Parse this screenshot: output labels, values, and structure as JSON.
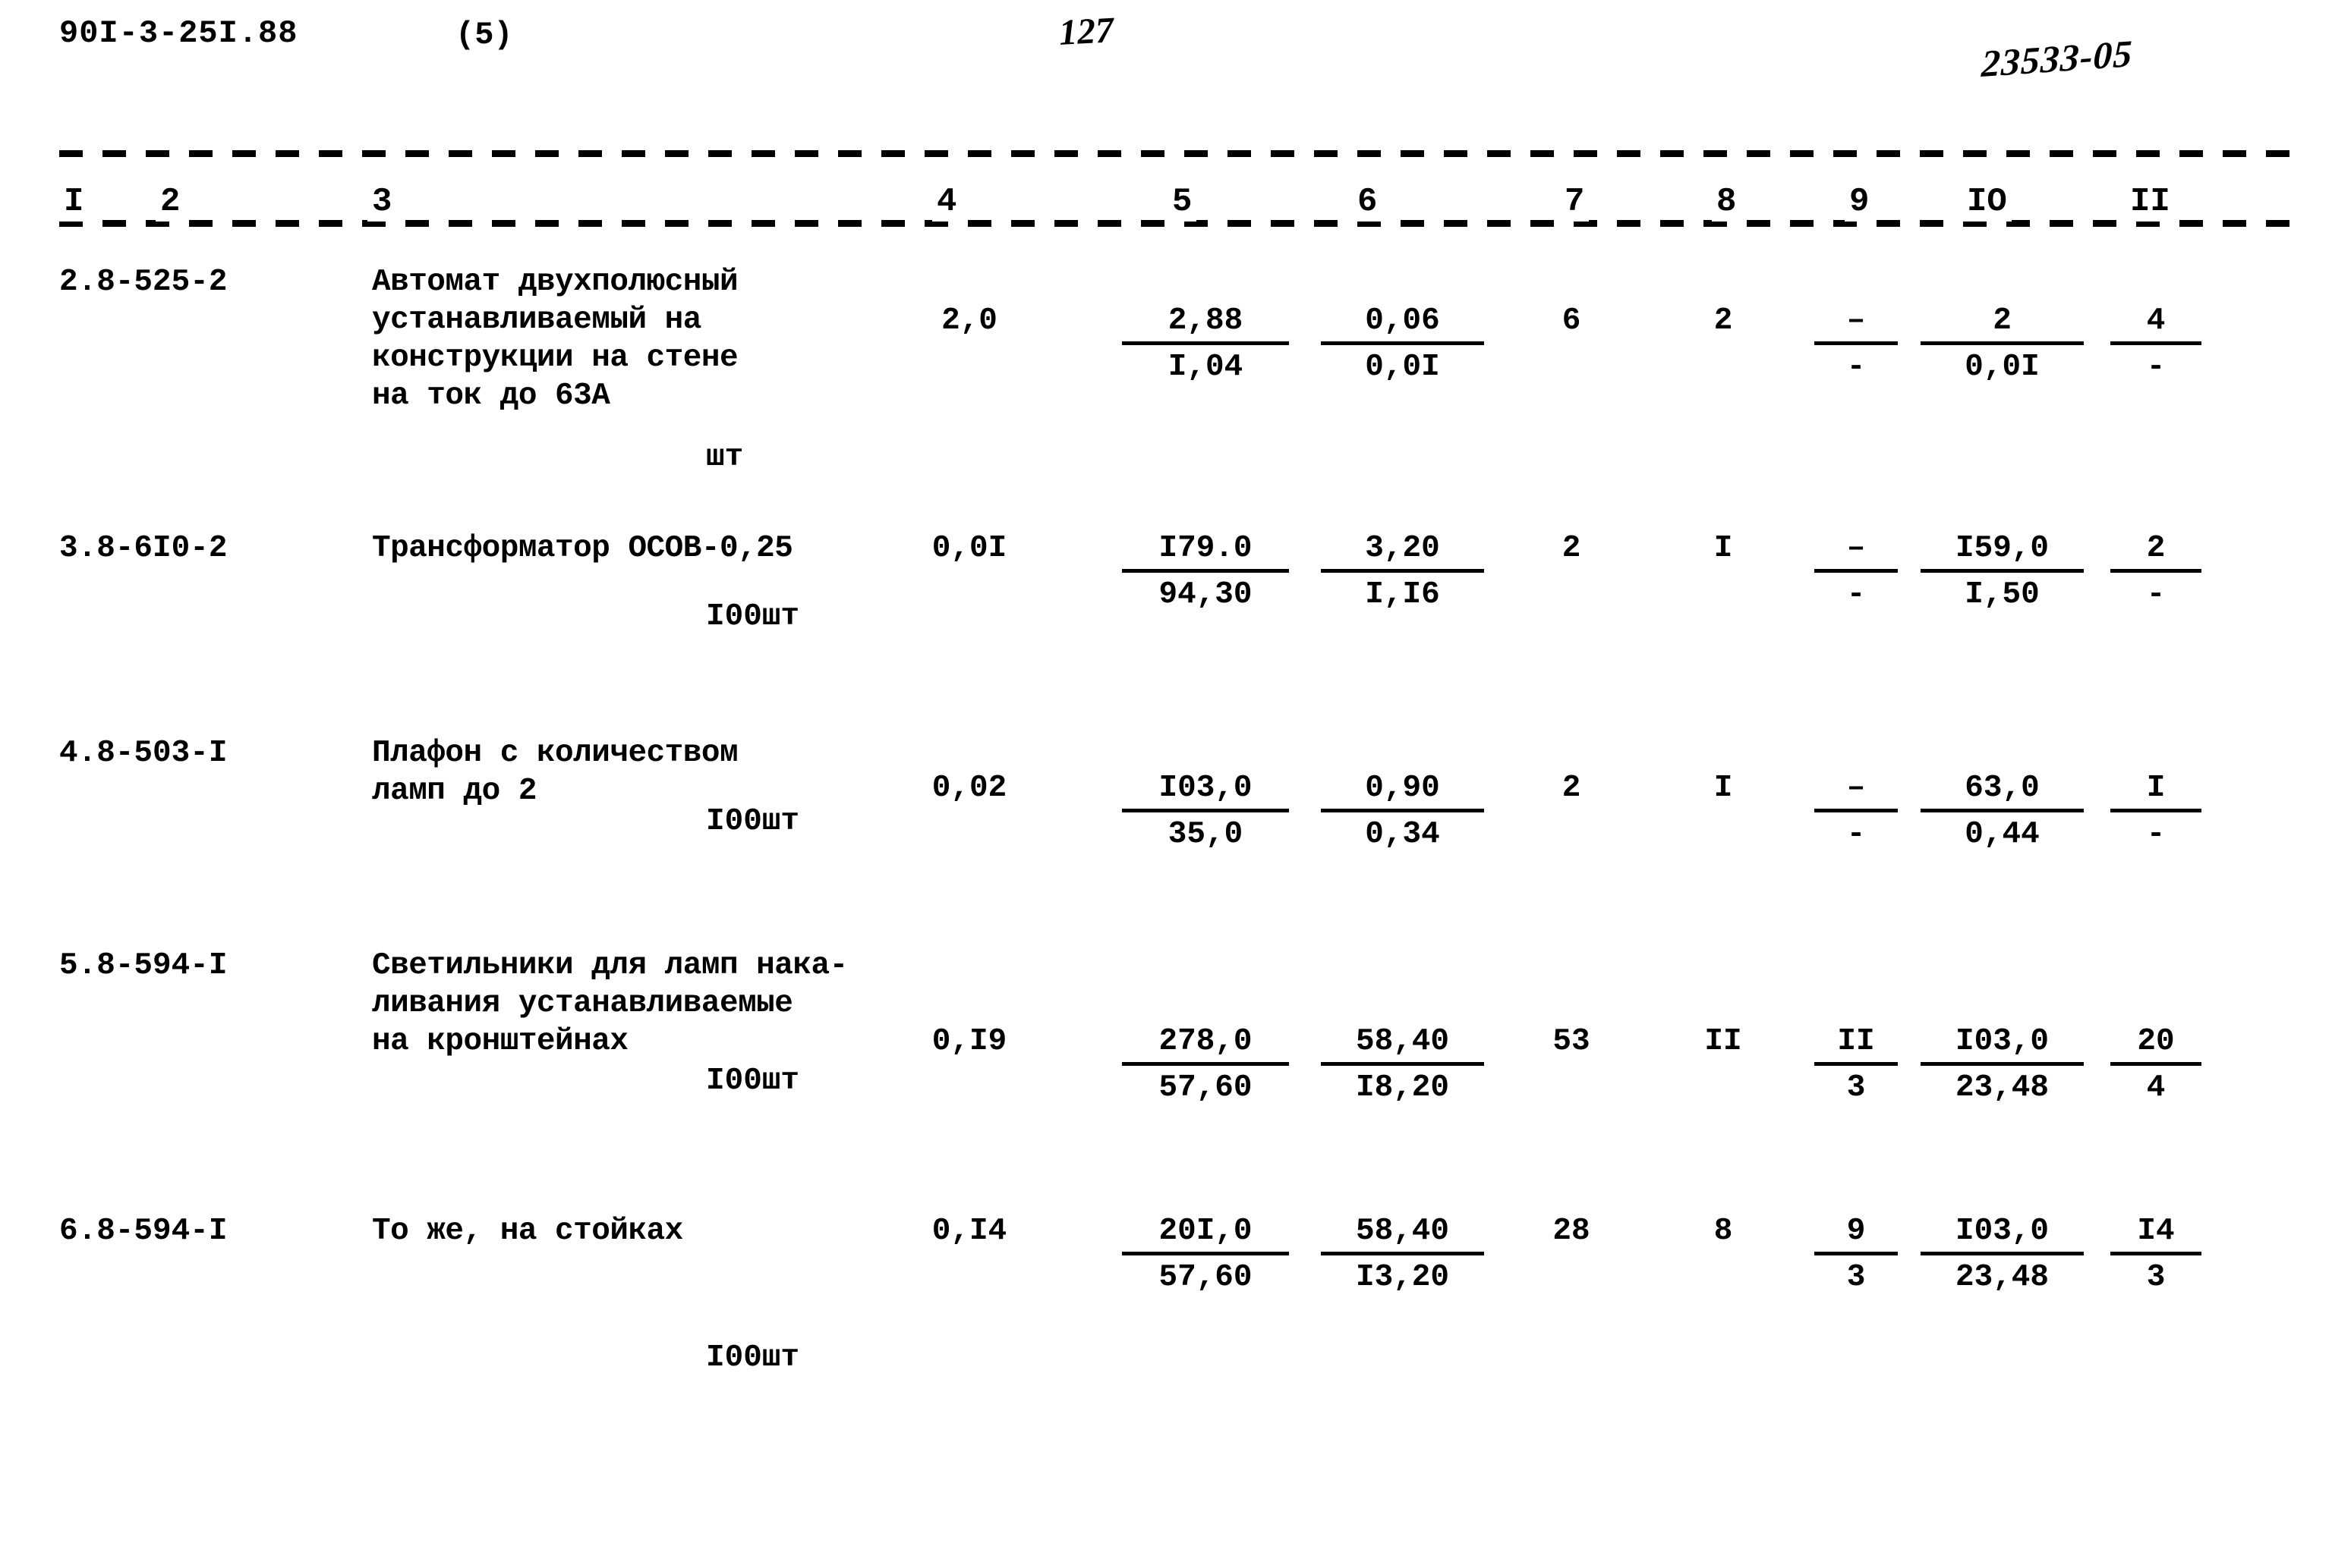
{
  "header": {
    "doc_code": "90I-3-25I.88",
    "sheet_no": "(5)",
    "page_no": "127",
    "stamp": "23533-05"
  },
  "table": {
    "column_numbers": [
      "I",
      "2",
      "3",
      "4",
      "5",
      "6",
      "7",
      "8",
      "9",
      "IO",
      "II"
    ],
    "rows": [
      {
        "code": "2.8-525-2",
        "name": "Автомат двухполюсный\nустанавливаемый на\nконструкции на стене\nна ток до 63А",
        "unit": "шт",
        "col4": "2,0",
        "col5_top": "2,88",
        "col5_bot": "I,04",
        "col6_top": "0,06",
        "col6_bot": "0,0I",
        "col7": "6",
        "col8": "2",
        "col9_top": "–",
        "col9_bot": "-",
        "col10_top": "2",
        "col10_bot": "0,0I",
        "col11_top": "4",
        "col11_bot": "-"
      },
      {
        "code": "3.8-6I0-2",
        "name": "Трансформатор ОСОВ-0,25",
        "unit": "I00шт",
        "col4": "0,0I",
        "col5_top": "I79.0",
        "col5_bot": "94,30",
        "col6_top": "3,20",
        "col6_bot": "I,I6",
        "col7": "2",
        "col8": "I",
        "col9_top": "–",
        "col9_bot": "-",
        "col10_top": "I59,0",
        "col10_bot": "I,50",
        "col11_top": "2",
        "col11_bot": "-"
      },
      {
        "code": "4.8-503-I",
        "name": "Плафон с количеством\nламп до 2",
        "unit": "I00шт",
        "col4": "0,02",
        "col5_top": "I03,0",
        "col5_bot": "35,0",
        "col6_top": "0,90",
        "col6_bot": "0,34",
        "col7": "2",
        "col8": "I",
        "col9_top": "–",
        "col9_bot": "-",
        "col10_top": "63,0",
        "col10_bot": "0,44",
        "col11_top": "I",
        "col11_bot": "-"
      },
      {
        "code": "5.8-594-I",
        "name": "Светильники для ламп нака-\nливания устанавливаемые\nна кронштейнах",
        "unit": "I00шт",
        "col4": "0,I9",
        "col5_top": "278,0",
        "col5_bot": "57,60",
        "col6_top": "58,40",
        "col6_bot": "I8,20",
        "col7": "53",
        "col8": "II",
        "col9_top": "II",
        "col9_bot": "3",
        "col10_top": "I03,0",
        "col10_bot": "23,48",
        "col11_top": "20",
        "col11_bot": "4"
      },
      {
        "code": "6.8-594-I",
        "name": "То же, на стойках",
        "unit": "I00шт",
        "col4": "0,I4",
        "col5_top": "20I,0",
        "col5_bot": "57,60",
        "col6_top": "58,40",
        "col6_bot": "I3,20",
        "col7": "28",
        "col8": "8",
        "col9_top": "9",
        "col9_bot": "3",
        "col10_top": "I03,0",
        "col10_bot": "23,48",
        "col11_top": "I4",
        "col11_bot": "3"
      }
    ]
  }
}
